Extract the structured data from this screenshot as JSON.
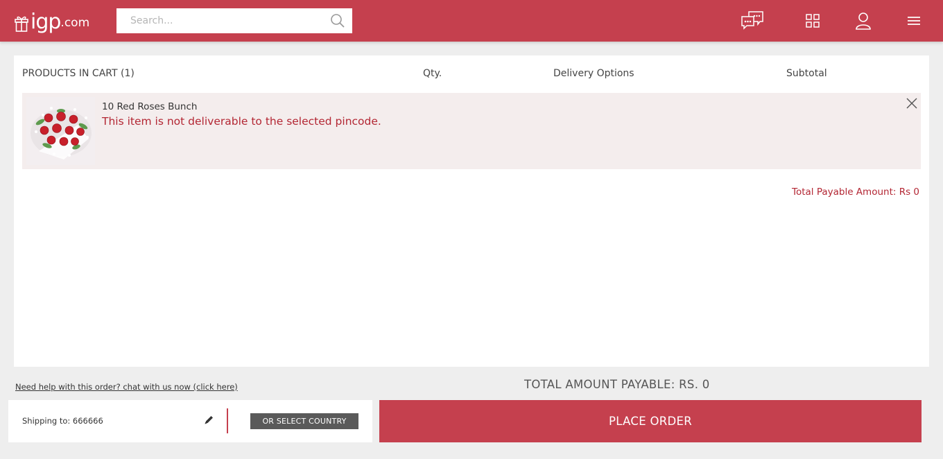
{
  "header": {
    "logo_text": "igp",
    "logo_suffix": ".com",
    "search_placeholder": "Search...",
    "icons": [
      "chat-icon",
      "grid-icon",
      "user-icon",
      "menu-icon"
    ]
  },
  "cart": {
    "columns": {
      "products": "PRODUCTS IN CART (1)",
      "qty": "Qty.",
      "delivery": "Delivery Options",
      "subtotal": "Subtotal"
    },
    "items": [
      {
        "name": "10 Red Roses Bunch",
        "error": "This item is not deliverable to the selected pincode."
      }
    ],
    "total_payable": "Total Payable Amount: Rs 0"
  },
  "footer": {
    "help_link": "Need help with this order? chat with us now (click here)",
    "total_amount": "TOTAL AMOUNT PAYABLE: RS. 0",
    "shipping_label": "Shipping to: 666666",
    "select_country": "OR SELECT COUNTRY",
    "place_order": "PLACE ORDER"
  },
  "colors": {
    "brand": "#c5404e",
    "error": "#b32633",
    "item_bg": "#f4eded"
  }
}
